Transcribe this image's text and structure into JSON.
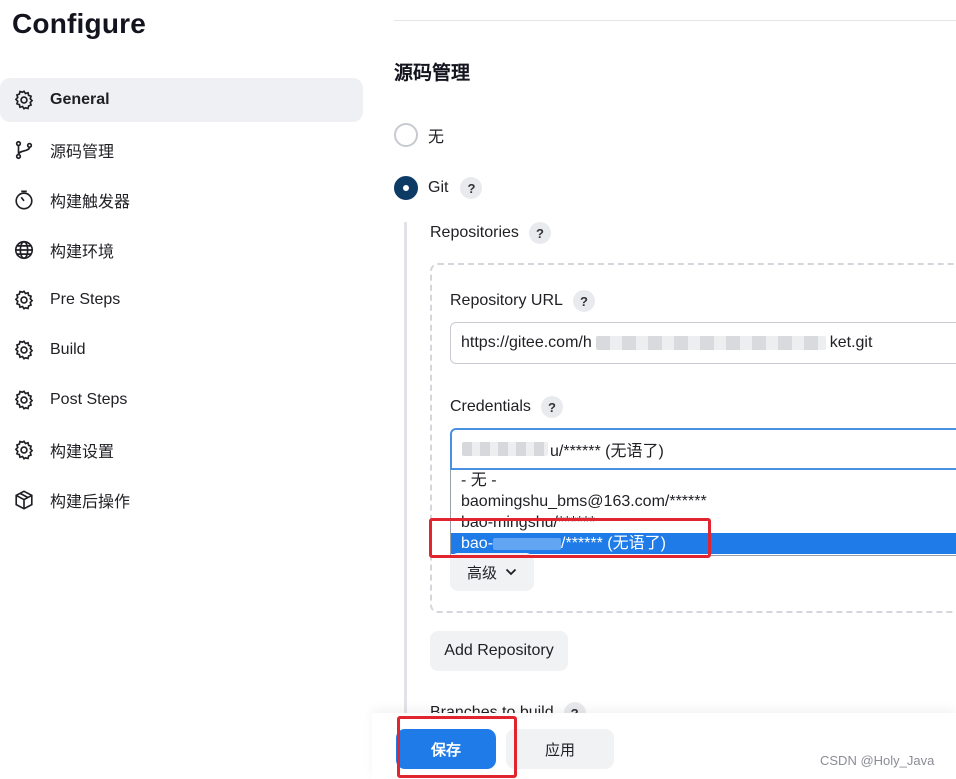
{
  "page": {
    "title": "Configure"
  },
  "sidebar": {
    "items": [
      {
        "label": "General",
        "icon": "gear-icon",
        "active": true
      },
      {
        "label": "源码管理",
        "icon": "branch-icon",
        "active": false
      },
      {
        "label": "构建触发器",
        "icon": "timer-icon",
        "active": false
      },
      {
        "label": "构建环境",
        "icon": "globe-icon",
        "active": false
      },
      {
        "label": "Pre Steps",
        "icon": "gear-icon",
        "active": false
      },
      {
        "label": "Build",
        "icon": "gear-icon",
        "active": false
      },
      {
        "label": "Post Steps",
        "icon": "gear-icon",
        "active": false
      },
      {
        "label": "构建设置",
        "icon": "gear-icon",
        "active": false
      },
      {
        "label": "构建后操作",
        "icon": "package-icon",
        "active": false
      }
    ]
  },
  "scm": {
    "section_title": "源码管理",
    "options": {
      "none_label": "无",
      "git_label": "Git",
      "selected": "Git"
    },
    "help_symbol": "?",
    "repositories_label": "Repositories",
    "repository_url": {
      "label": "Repository URL",
      "value_prefix": "https://gitee.com/h",
      "value_suffix": "ket.git"
    },
    "credentials": {
      "label": "Credentials",
      "selected_value": "u/****** (无语了)",
      "options": [
        {
          "label": "- 无 -",
          "selected": false
        },
        {
          "label": "baomingshu_bms@163.com/******",
          "selected": false
        },
        {
          "label": "bao-mingshu/******",
          "selected": false
        },
        {
          "label": "bao-",
          "label_suffix": "/****** (无语了)",
          "selected": true
        }
      ]
    },
    "advanced_label": "高级",
    "add_repository_label": "Add Repository",
    "branches_label": "Branches to build"
  },
  "footer": {
    "save_label": "保存",
    "apply_label": "应用"
  },
  "watermark": "CSDN @Holy_Java",
  "colors": {
    "primary": "#1e7be8",
    "radio_checked": "#0d3b66",
    "highlight": "#e0252e",
    "active_bg": "#eff0f3"
  }
}
